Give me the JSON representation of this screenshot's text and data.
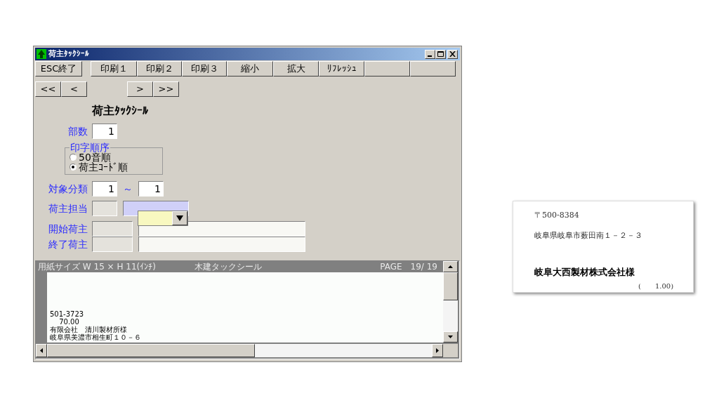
{
  "window": {
    "title": "荷主ﾀｯｸｼｰﾙ"
  },
  "toolbar": [
    {
      "label": "ESC終了"
    },
    {
      "label": "印刷１"
    },
    {
      "label": "印刷２"
    },
    {
      "label": "印刷３"
    },
    {
      "label": "縮小"
    },
    {
      "label": "拡大"
    },
    {
      "label": "ﾘﾌﾚｯｼｭ"
    }
  ],
  "nav": [
    "<<",
    "<",
    ">",
    ">>"
  ],
  "heading": "荷主ﾀｯｸｼｰﾙ",
  "copies": {
    "label": "部数",
    "value": "1"
  },
  "print_order": {
    "legend": "印字順序",
    "options": [
      {
        "label": "50音順",
        "selected": false
      },
      {
        "label": "荷主ｺｰﾄﾞ順",
        "selected": true
      }
    ]
  },
  "category_range": {
    "label": "対象分類",
    "from": "1",
    "separator": "～",
    "to": "1"
  },
  "shipper_staff": {
    "label": "荷主担当"
  },
  "start_shipper": {
    "label": "開始荷主"
  },
  "end_shipper": {
    "label": "終了荷主"
  },
  "preview": {
    "paper_size": "用紙サイズ W 15 × H 11(ｲﾝﾁ)",
    "title": "木建タックシール",
    "page": "PAGE　19/ 19",
    "lines": [
      "501-3723",
      "　 70.00",
      "有限会社　清川製材所様",
      "岐阜県美濃市相生町１０－６"
    ]
  },
  "label_card": {
    "postal": "〒500-8384",
    "address": "岐阜県岐阜市薮田南１－２－３",
    "name": "岐阜大西製材株式会社様",
    "quantity": "(　　1.00)"
  }
}
